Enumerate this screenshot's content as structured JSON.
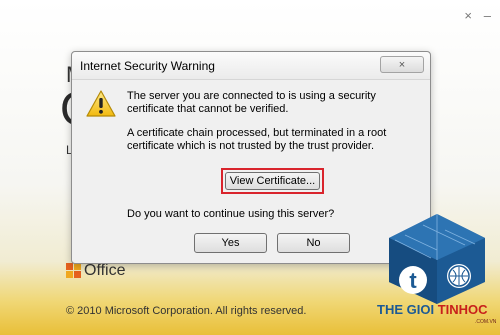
{
  "background": {
    "letter_m": "M",
    "big_o": "O",
    "letter_l": "L",
    "office_text": "Office",
    "copyright": "© 2010 Microsoft Corporation.  All rights reserved.",
    "close_glyph": "×",
    "minimize_glyph": "–"
  },
  "dialog": {
    "title": "Internet Security Warning",
    "close_glyph": "×",
    "icon": "warning-triangle-icon",
    "message_1": "The server you are connected to is using a security certificate that cannot be verified.",
    "message_2": "A certificate chain processed, but terminated in a root certificate which is not trusted by the trust provider.",
    "view_certificate_label": "View Certificate...",
    "question": "Do you want to continue using this server?",
    "yes_label": "Yes",
    "no_label": "No",
    "highlight_color": "#d9242c"
  },
  "watermark": {
    "brand_part1": "THE GIOI",
    "brand_part2": "TINHOC",
    "sub": ".COM.VN",
    "brand_color1": "#1c5a94",
    "brand_color2": "#c8201b"
  }
}
